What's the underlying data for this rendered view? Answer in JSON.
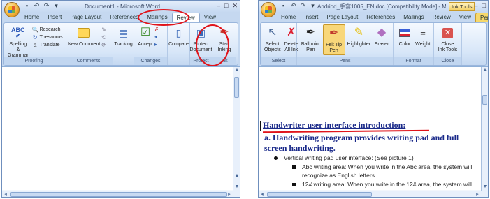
{
  "left": {
    "title": "Document1 - Microsoft Word",
    "tabs": [
      "Home",
      "Insert",
      "Page Layout",
      "References",
      "Mailings",
      "Review",
      "View"
    ],
    "selected_tab": "Review",
    "groups": [
      {
        "label": "Proofing",
        "items": [
          "Spelling & Grammar",
          "Research",
          "Thesaurus",
          "Translate"
        ]
      },
      {
        "label": "Comments",
        "items": [
          "New Comment"
        ]
      },
      {
        "label": "Tracking",
        "items": [
          "Tracking"
        ]
      },
      {
        "label": "Changes",
        "items": [
          "Accept"
        ]
      },
      {
        "label": "Compare",
        "items": [
          "Compare"
        ]
      },
      {
        "label": "Protect",
        "items": [
          "Protect Document"
        ]
      },
      {
        "label": "Ink",
        "items": [
          "Start Inking"
        ]
      }
    ]
  },
  "right": {
    "title": "Andriod_手寫1005_EN.doc [Compatibility Mode] - Microsof...",
    "contextual_tab": "Ink Tools",
    "tabs": [
      "Home",
      "Insert",
      "Page Layout",
      "References",
      "Mailings",
      "Review",
      "View",
      "Pens"
    ],
    "selected_tab": "Pens",
    "groups": [
      {
        "label": "Select",
        "items": [
          "Select Objects",
          "Delete All Ink"
        ]
      },
      {
        "label": "Pens",
        "items": [
          "Ballpoint Pen",
          "Felt Tip Pen",
          "Highlighter",
          "Eraser"
        ]
      },
      {
        "label": "Format",
        "items": [
          "Color",
          "Weight"
        ]
      },
      {
        "label": "Close",
        "items": [
          "Close Ink Tools"
        ]
      }
    ],
    "doc": {
      "heading": "Handwriter user interface introduction:",
      "subheading": "a. Handwriting program provides writing pad and full screen handwriting.",
      "bullet": "Vertical writing pad user interface: (See picture 1)",
      "sub1": "Abc writing area: When you write in the Abc area, the system will recognize as English letters.",
      "sub2": "12# writing area: When you write in the 12# area, the system will"
    }
  },
  "colors": {
    "annotation_red": "#e0141b",
    "ribbon_blue": "#c5d8f0",
    "heading_blue": "#1a2a8a"
  }
}
